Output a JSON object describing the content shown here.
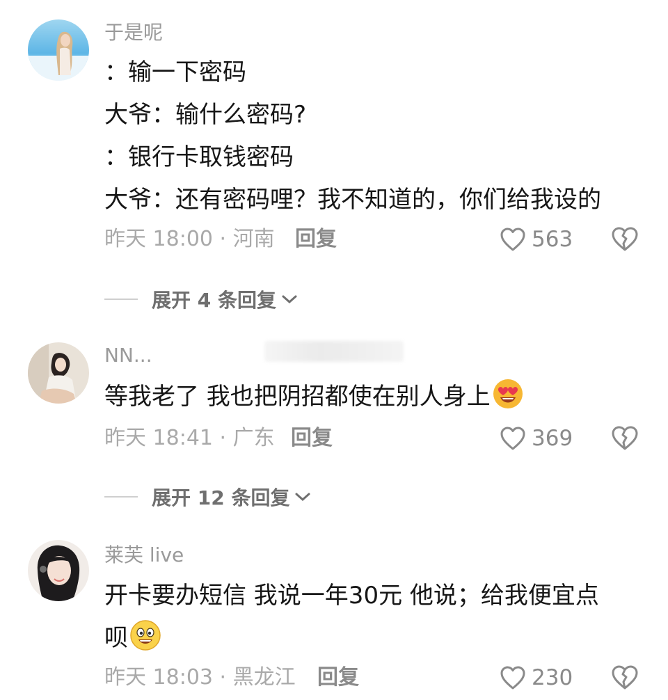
{
  "comments": [
    {
      "username": "于是呢",
      "lines": [
        "：输一下密码",
        "大爷：输什么密码?",
        "：银行卡取钱密码",
        "大爷：还有密码哩？我不知道的，你们给我设的"
      ],
      "meta": "昨天 18:00 · 河南",
      "reply_label": "回复",
      "likes": "563",
      "expand_label": "展开 4 条回复"
    },
    {
      "username": "NN...",
      "lines": [
        "等我老了 我也把阴招都使在别人身上"
      ],
      "emoji": "heart-eyes-emoji",
      "meta": "昨天 18:41 · 广东",
      "reply_label": "回复",
      "likes": "369",
      "expand_label": "展开 12 条回复"
    },
    {
      "username": "莱芙 live",
      "lines": [
        "开卡要办短信 我说一年30元 他说；给我便宜点",
        "呗"
      ],
      "emoji": "grinning-emoji",
      "meta": "昨天 18:03 · 黑龙江",
      "reply_label": "回复",
      "likes": "230"
    }
  ],
  "icons": {
    "like": "heart-outline-icon",
    "dislike": "broken-heart-icon",
    "expand": "chevron-down-icon"
  },
  "colors": {
    "meta_text": "#a9a9a9",
    "username": "#9a9a9a",
    "body_text": "#161616"
  }
}
